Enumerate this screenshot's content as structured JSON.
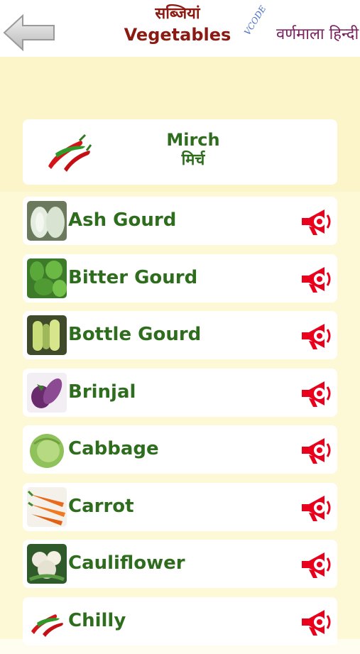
{
  "header": {
    "title_hindi": "सब्जियां",
    "title_english": "Vegetables",
    "brand_code": "VCODE",
    "brand_name": "वर्णमाला हिन्दी"
  },
  "featured": {
    "name_english": "Mirch",
    "name_hindi": "मिर्च",
    "icon": "chilli-image"
  },
  "items": [
    {
      "label": "Ash Gourd",
      "icon": "ash-gourd-image"
    },
    {
      "label": "Bitter Gourd",
      "icon": "bitter-gourd-image"
    },
    {
      "label": "Bottle Gourd",
      "icon": "bottle-gourd-image"
    },
    {
      "label": "Brinjal",
      "icon": "brinjal-image"
    },
    {
      "label": "Cabbage",
      "icon": "cabbage-image"
    },
    {
      "label": "Carrot",
      "icon": "carrot-image"
    },
    {
      "label": "Cauliflower",
      "icon": "cauliflower-image"
    },
    {
      "label": "Chilly",
      "icon": "chilli-image"
    }
  ],
  "colors": {
    "title": "#8b1a12",
    "label": "#2f6d1e",
    "speaker": "#e8001c",
    "background": "#fbf5c9"
  }
}
